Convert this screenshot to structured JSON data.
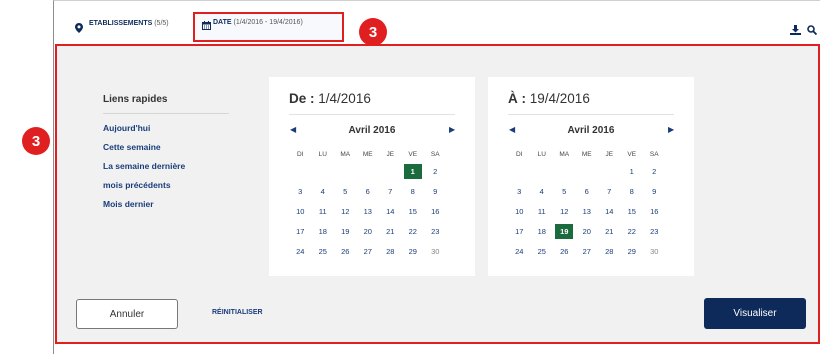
{
  "topbar": {
    "establishments_label": "ETABLISSEMENTS",
    "establishments_count": "(5/5)",
    "date_label": "DATE",
    "date_range": "(1/4/2016 - 19/4/2016)"
  },
  "badges": {
    "top": "3",
    "left": "3"
  },
  "quick_links": {
    "title": "Liens rapides",
    "items": [
      "Aujourd'hui",
      "Cette semaine",
      "La semaine dernière",
      "mois précédents",
      "Mois dernier"
    ]
  },
  "calendar_from": {
    "prefix": "De :",
    "date": "1/4/2016",
    "month": "Avril 2016",
    "weekdays": [
      "DI",
      "LU",
      "MA",
      "ME",
      "JE",
      "VE",
      "SA"
    ],
    "weeks": [
      [
        "",
        "",
        "",
        "",
        "",
        "1",
        "2"
      ],
      [
        "3",
        "4",
        "5",
        "6",
        "7",
        "8",
        "9"
      ],
      [
        "10",
        "11",
        "12",
        "13",
        "14",
        "15",
        "16"
      ],
      [
        "17",
        "18",
        "19",
        "20",
        "21",
        "22",
        "23"
      ],
      [
        "24",
        "25",
        "26",
        "27",
        "28",
        "29",
        "30"
      ]
    ],
    "selected": "1"
  },
  "calendar_to": {
    "prefix": "À :",
    "date": "19/4/2016",
    "month": "Avril 2016",
    "weekdays": [
      "DI",
      "LU",
      "MA",
      "ME",
      "JE",
      "VE",
      "SA"
    ],
    "weeks": [
      [
        "",
        "",
        "",
        "",
        "",
        "1",
        "2"
      ],
      [
        "3",
        "4",
        "5",
        "6",
        "7",
        "8",
        "9"
      ],
      [
        "10",
        "11",
        "12",
        "13",
        "14",
        "15",
        "16"
      ],
      [
        "17",
        "18",
        "19",
        "20",
        "21",
        "22",
        "23"
      ],
      [
        "24",
        "25",
        "26",
        "27",
        "28",
        "29",
        "30"
      ]
    ],
    "selected": "19"
  },
  "footer": {
    "cancel_label": "Annuler",
    "reset_label": "RÉINITIALISER",
    "view_label": "Visualiser"
  },
  "colors": {
    "navy": "#0e2a5a",
    "link": "#1a3d7a",
    "selected_day": "#1b6b3f",
    "highlight_red": "#e02020",
    "panel_bg": "#f1f1f1"
  },
  "icons": [
    "map-pin-icon",
    "calendar-icon",
    "download-icon",
    "search-icon",
    "chevron-left-icon",
    "chevron-right-icon"
  ]
}
